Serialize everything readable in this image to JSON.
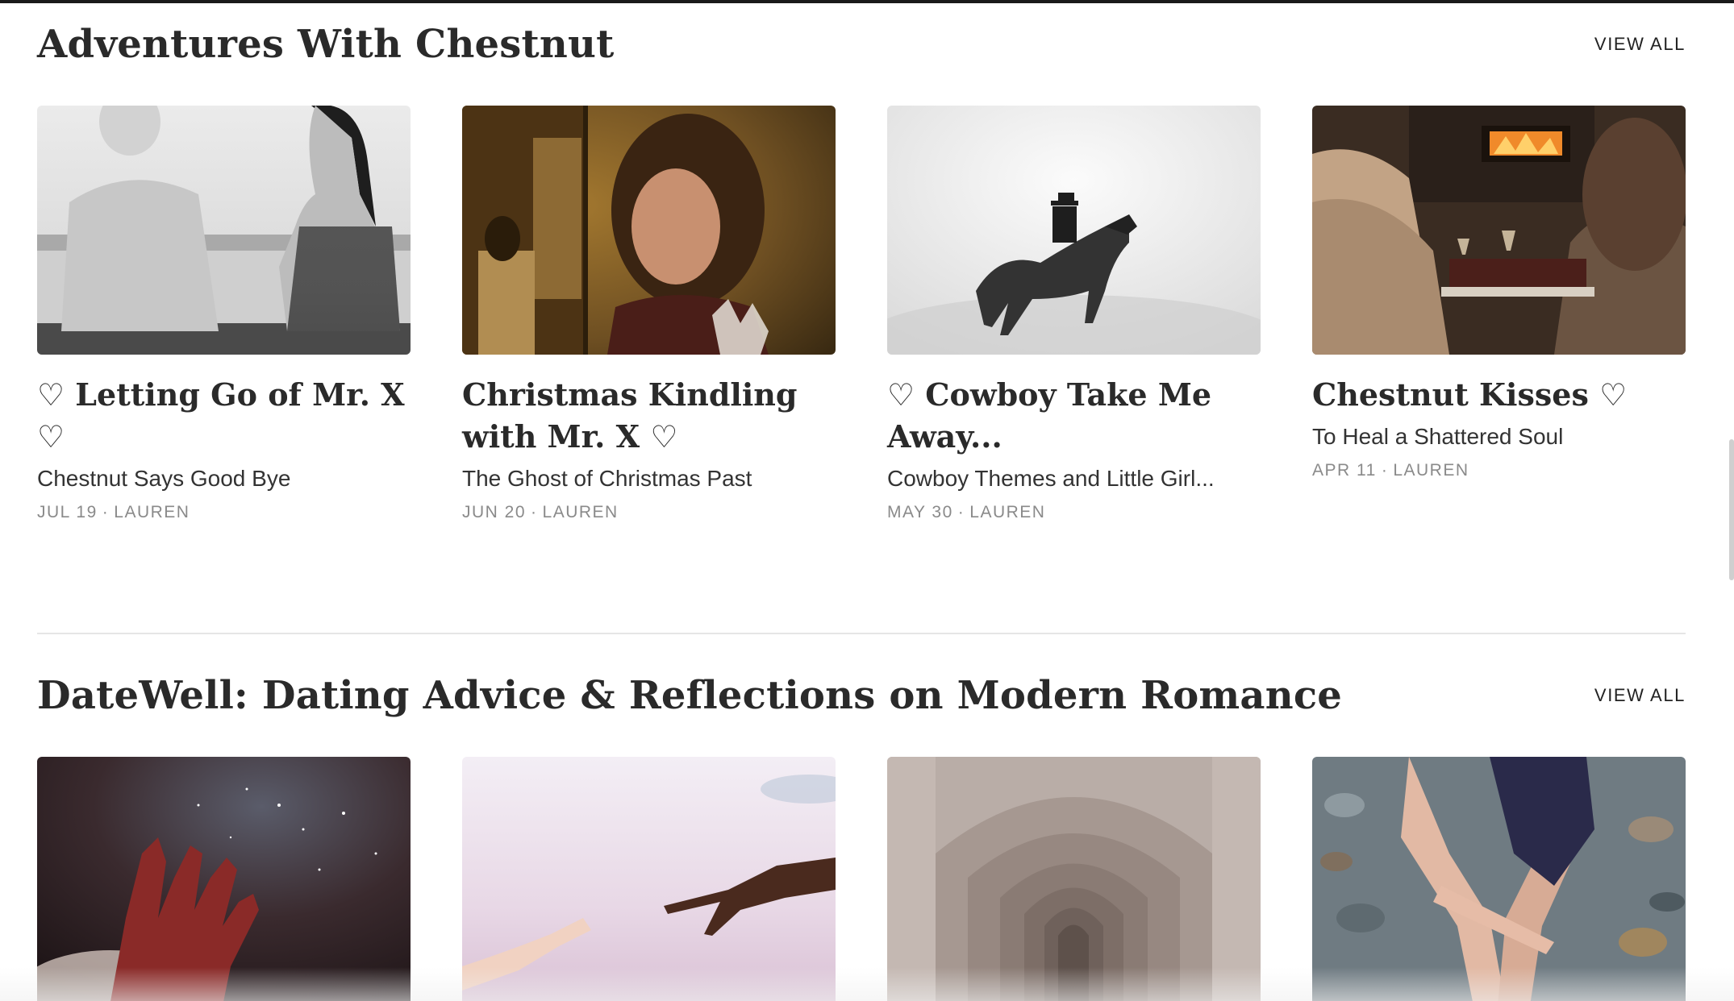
{
  "sections": [
    {
      "title": "Adventures With Chestnut",
      "view_all": "VIEW ALL",
      "posts": [
        {
          "title": "♡ Letting Go of Mr. X ♡",
          "subtitle": "Chestnut Says Good Bye",
          "date": "JUL 19",
          "author": "LAUREN"
        },
        {
          "title": "Christmas Kindling with Mr. X ♡",
          "subtitle": "The Ghost of Christmas Past",
          "date": "JUN 20",
          "author": "LAUREN"
        },
        {
          "title": "♡ Cowboy Take Me Away...",
          "subtitle": "Cowboy Themes and Little Girl...",
          "date": "MAY 30",
          "author": "LAUREN"
        },
        {
          "title": "Chestnut Kisses ♡",
          "subtitle": "To Heal a Shattered Soul",
          "date": "APR 11",
          "author": "LAUREN"
        }
      ]
    },
    {
      "title": "DateWell: Dating Advice & Reflections on Modern Romance",
      "view_all": "VIEW ALL"
    }
  ],
  "meta_separator": "·"
}
